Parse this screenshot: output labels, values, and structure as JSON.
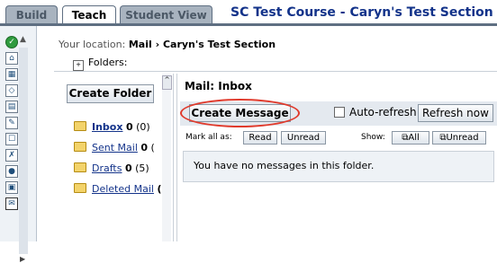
{
  "tabs": [
    {
      "label": "Build",
      "active": false
    },
    {
      "label": "Teach",
      "active": true
    },
    {
      "label": "Student View",
      "active": false
    }
  ],
  "course_title": "SC Test Course - Caryn's Test Section",
  "iconbar": {
    "icons": [
      "green-circle-icon",
      "home-icon",
      "calendar-icon",
      "syllabus-icon",
      "content-icon",
      "learning-icon",
      "discussion-icon",
      "pin-icon",
      "assessment-icon",
      "grade-icon",
      "mail-icon"
    ]
  },
  "location": {
    "prefix": "Your location:",
    "path": "Mail › Caryn's Test Section"
  },
  "folders_label": "Folders:",
  "sidebar": {
    "create_folder": "Create Folder",
    "folders": [
      {
        "name": "Inbox",
        "unread": "0",
        "total": "(0)",
        "selected": true
      },
      {
        "name": "Sent Mail",
        "unread": "0",
        "total": "(",
        "selected": false
      },
      {
        "name": "Drafts",
        "unread": "0",
        "total": "(5)",
        "selected": false
      },
      {
        "name": "Deleted Mail",
        "unread": "(",
        "total": "",
        "selected": false
      }
    ]
  },
  "main": {
    "title": "Mail: Inbox",
    "create_message": "Create Message",
    "auto_refresh": "Auto-refresh",
    "refresh_now": "Refresh now",
    "mark_all_as": "Mark all as:",
    "read": "Read",
    "unread": "Unread",
    "show": "Show:",
    "show_all": "All",
    "show_unread": "Unread",
    "empty_message": "You have no messages in this folder."
  },
  "colors": {
    "highlight_oval": "#e03a2c",
    "link": "#13338a",
    "course_title": "#13338a"
  }
}
